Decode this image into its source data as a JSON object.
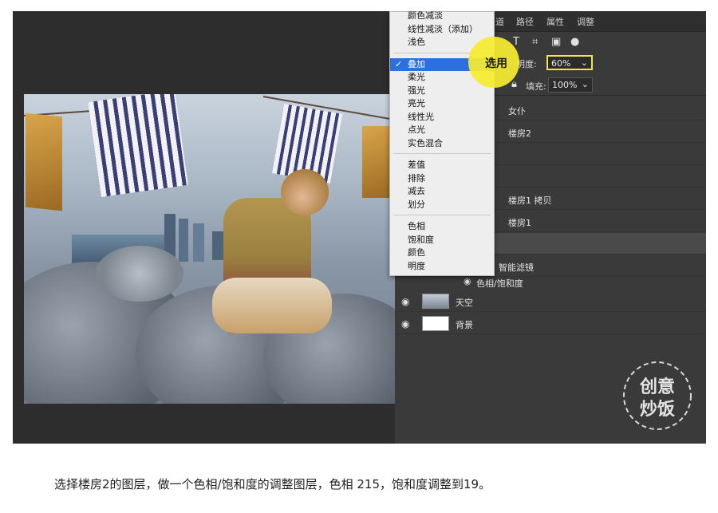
{
  "panel": {
    "tabs": [
      "道",
      "路径",
      "属性",
      "调整"
    ],
    "opacity_label": "明度:",
    "opacity_value": "60%",
    "fill_label": "填充:",
    "fill_value": "100%",
    "layers": [
      {
        "name": "女仆"
      },
      {
        "name": "楼房2"
      },
      {
        "name": ""
      },
      {
        "name": ""
      },
      {
        "name": "楼房1 拷贝"
      },
      {
        "name": "楼房1"
      },
      {
        "name": ""
      },
      {
        "name": "智能滤镜"
      },
      {
        "name": "色相/饱和度"
      },
      {
        "name": "天空"
      },
      {
        "name": "背景"
      }
    ]
  },
  "blend_menu": {
    "groups": [
      [
        "颜色减淡",
        "线性减淡（添加）",
        "浅色"
      ],
      [
        "叠加",
        "柔光",
        "强光",
        "亮光",
        "线性光",
        "点光",
        "实色混合"
      ],
      [
        "差值",
        "排除",
        "减去",
        "划分"
      ],
      [
        "色相",
        "饱和度",
        "颜色",
        "明度"
      ]
    ],
    "selected": "叠加"
  },
  "highlight": {
    "label": "选用"
  },
  "logo": {
    "line1": "创意",
    "line2": "炒饭"
  },
  "caption": "选择楼房2的图层，做一个色相/饱和度的调整图层，色相 215，饱和度调整到19。",
  "colors": {
    "accent": "#2c6fe0",
    "highlight": "#f6ec2f",
    "panel_bg": "#3a3a3a"
  }
}
